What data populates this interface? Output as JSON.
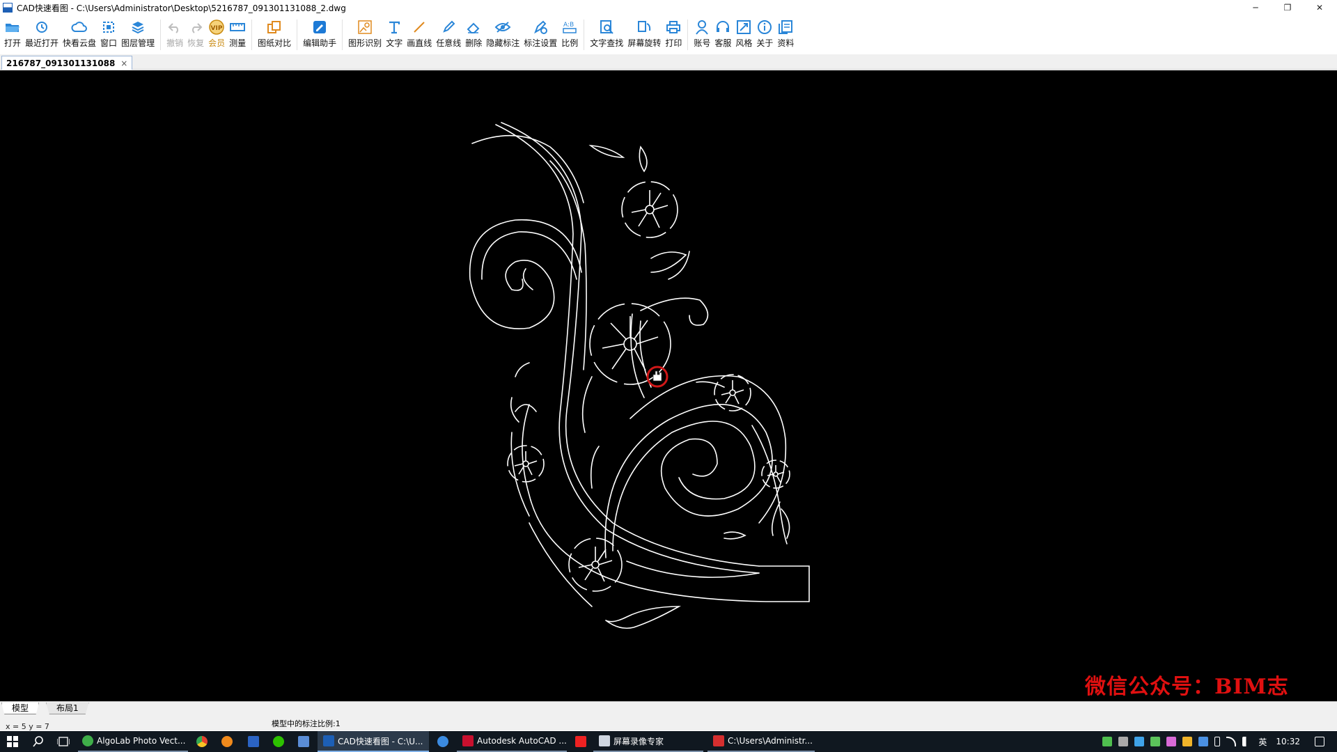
{
  "window": {
    "title": "CAD快速看图 - C:\\Users\\Administrator\\Desktop\\5216787_091301131088_2.dwg",
    "minimize": "─",
    "restore": "❐",
    "close": "✕"
  },
  "toolbar": {
    "items": [
      {
        "label": "打开",
        "icon": "folder-open-icon"
      },
      {
        "label": "最近打开",
        "icon": "recent-clock-icon"
      },
      {
        "label": "快看云盘",
        "icon": "cloud-icon"
      },
      {
        "label": "窗口",
        "icon": "window-select-icon"
      },
      {
        "label": "图层管理",
        "icon": "layers-icon"
      },
      {
        "label": "撤销",
        "icon": "undo-icon"
      },
      {
        "label": "恢复",
        "icon": "redo-icon"
      },
      {
        "label": "会员",
        "icon": "vip-badge-icon"
      },
      {
        "label": "测量",
        "icon": "ruler-icon"
      },
      {
        "label": "图纸对比",
        "icon": "compare-icon"
      },
      {
        "label": "编辑助手",
        "icon": "edit-assistant-icon"
      },
      {
        "label": "图形识别",
        "icon": "shape-recognize-icon"
      },
      {
        "label": "文字",
        "icon": "text-t-icon"
      },
      {
        "label": "画直线",
        "icon": "line-icon"
      },
      {
        "label": "任意线",
        "icon": "pencil-icon"
      },
      {
        "label": "删除",
        "icon": "eraser-icon"
      },
      {
        "label": "隐藏标注",
        "icon": "eye-hide-icon"
      },
      {
        "label": "标注设置",
        "icon": "annotation-settings-icon"
      },
      {
        "label": "比例",
        "icon": "scale-icon"
      },
      {
        "label": "文字查找",
        "icon": "text-search-icon"
      },
      {
        "label": "屏幕旋转",
        "icon": "rotate-screen-icon"
      },
      {
        "label": "打印",
        "icon": "printer-icon"
      },
      {
        "label": "账号",
        "icon": "user-icon"
      },
      {
        "label": "客服",
        "icon": "headset-icon"
      },
      {
        "label": "风格",
        "icon": "style-icon"
      },
      {
        "label": "关于",
        "icon": "info-icon"
      },
      {
        "label": "资料",
        "icon": "documents-icon"
      }
    ]
  },
  "doc_tab": {
    "label": "216787_091301131088",
    "close": "×"
  },
  "canvas": {
    "watermark": "微信公众号：BIM志"
  },
  "layout_tabs": {
    "model": "模型",
    "layout1": "布局1"
  },
  "status": {
    "scale_text": "模型中的标注比例:1",
    "coords": "x = 5  y = 7"
  },
  "taskbar": {
    "start_icon": "windows-start-icon",
    "apps": [
      {
        "label": "AlgoLab Photo Vect...",
        "icon": "algolab-icon"
      },
      {
        "label": "CAD快速看图 - C:\\U...",
        "icon": "cad-viewer-icon"
      },
      {
        "label": "Autodesk AutoCAD ...",
        "icon": "autocad-icon"
      },
      {
        "label": "屏幕录像专家",
        "icon": "screen-recorder-icon"
      },
      {
        "label": "C:\\Users\\Administr...",
        "icon": "explorer-icon"
      }
    ],
    "ime": "英",
    "time": "10:32"
  },
  "colors": {
    "canvas_bg": "#000000",
    "drawing_stroke": "#ffffff",
    "watermark": "#e01010",
    "cursor_ring": "#d01818",
    "accent": "#1d7ad6"
  }
}
